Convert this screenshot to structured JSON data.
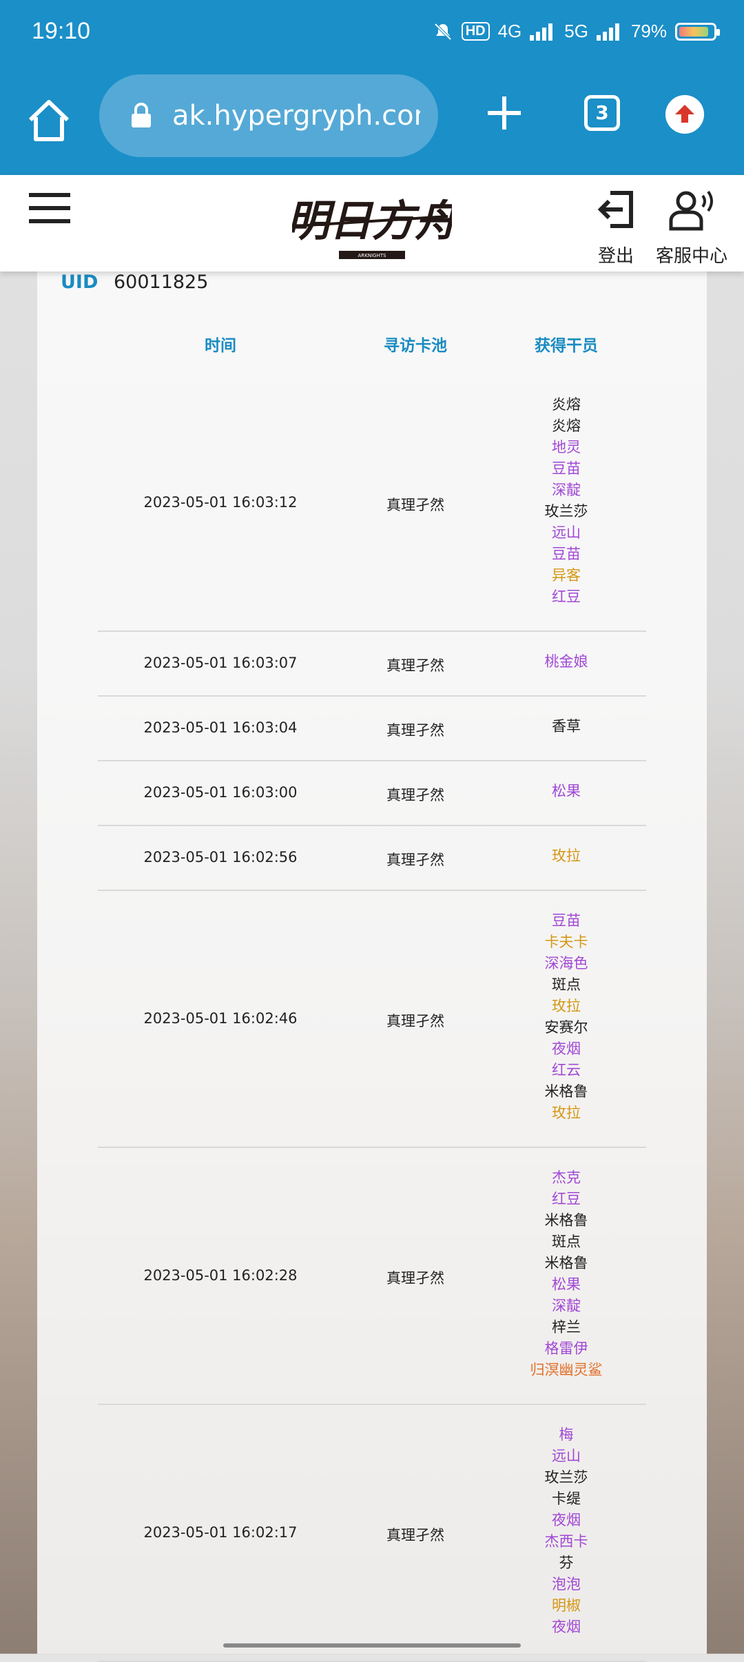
{
  "status_bar": {
    "time": "19:10",
    "hd": "HD",
    "network": "4G",
    "network2": "5G",
    "battery": "79%"
  },
  "browser": {
    "url": "ak.hypergryph.com/",
    "tab_count": "3"
  },
  "header": {
    "logout_label": "登出",
    "service_label": "客服中心",
    "logo_text": "明日方舟",
    "logo_sub": "ARKNIGHTS"
  },
  "uid": {
    "label": "UID",
    "value": "60011825"
  },
  "table": {
    "headers": [
      "时间",
      "寻访卡池",
      "获得干员"
    ],
    "rows": [
      {
        "time": "2023-05-01 16:03:12",
        "pool": "真理孑然",
        "operators": [
          {
            "name": "炎熔",
            "rarity": "3"
          },
          {
            "name": "炎熔",
            "rarity": "3"
          },
          {
            "name": "地灵",
            "rarity": "4"
          },
          {
            "name": "豆苗",
            "rarity": "4"
          },
          {
            "name": "深靛",
            "rarity": "4"
          },
          {
            "name": "玫兰莎",
            "rarity": "3"
          },
          {
            "name": "远山",
            "rarity": "4"
          },
          {
            "name": "豆苗",
            "rarity": "4"
          },
          {
            "name": "异客",
            "rarity": "5"
          },
          {
            "name": "红豆",
            "rarity": "4"
          }
        ]
      },
      {
        "time": "2023-05-01 16:03:07",
        "pool": "真理孑然",
        "operators": [
          {
            "name": "桃金娘",
            "rarity": "4"
          }
        ]
      },
      {
        "time": "2023-05-01 16:03:04",
        "pool": "真理孑然",
        "operators": [
          {
            "name": "香草",
            "rarity": "3"
          }
        ]
      },
      {
        "time": "2023-05-01 16:03:00",
        "pool": "真理孑然",
        "operators": [
          {
            "name": "松果",
            "rarity": "4"
          }
        ]
      },
      {
        "time": "2023-05-01 16:02:56",
        "pool": "真理孑然",
        "operators": [
          {
            "name": "玫拉",
            "rarity": "5"
          }
        ]
      },
      {
        "time": "2023-05-01 16:02:46",
        "pool": "真理孑然",
        "operators": [
          {
            "name": "豆苗",
            "rarity": "4"
          },
          {
            "name": "卡夫卡",
            "rarity": "5"
          },
          {
            "name": "深海色",
            "rarity": "4"
          },
          {
            "name": "斑点",
            "rarity": "3"
          },
          {
            "name": "玫拉",
            "rarity": "5"
          },
          {
            "name": "安赛尔",
            "rarity": "3"
          },
          {
            "name": "夜烟",
            "rarity": "4"
          },
          {
            "name": "红云",
            "rarity": "4"
          },
          {
            "name": "米格鲁",
            "rarity": "3"
          },
          {
            "name": "玫拉",
            "rarity": "5"
          }
        ]
      },
      {
        "time": "2023-05-01 16:02:28",
        "pool": "真理孑然",
        "operators": [
          {
            "name": "杰克",
            "rarity": "4"
          },
          {
            "name": "红豆",
            "rarity": "4"
          },
          {
            "name": "米格鲁",
            "rarity": "3"
          },
          {
            "name": "斑点",
            "rarity": "3"
          },
          {
            "name": "米格鲁",
            "rarity": "3"
          },
          {
            "name": "松果",
            "rarity": "4"
          },
          {
            "name": "深靛",
            "rarity": "4"
          },
          {
            "name": "梓兰",
            "rarity": "3"
          },
          {
            "name": "格雷伊",
            "rarity": "4"
          },
          {
            "name": "归溟幽灵鲨",
            "rarity": "6"
          }
        ]
      },
      {
        "time": "2023-05-01 16:02:17",
        "pool": "真理孑然",
        "operators": [
          {
            "name": "梅",
            "rarity": "4"
          },
          {
            "name": "远山",
            "rarity": "4"
          },
          {
            "name": "玫兰莎",
            "rarity": "3"
          },
          {
            "name": "卡缇",
            "rarity": "3"
          },
          {
            "name": "夜烟",
            "rarity": "4"
          },
          {
            "name": "杰西卡",
            "rarity": "4"
          },
          {
            "name": "芬",
            "rarity": "3"
          },
          {
            "name": "泡泡",
            "rarity": "4"
          },
          {
            "name": "明椒",
            "rarity": "5"
          },
          {
            "name": "夜烟",
            "rarity": "4"
          }
        ]
      }
    ]
  },
  "colors": {
    "brand_blue": "#1b8fc8",
    "header_text": "#1a8bc2",
    "rarity_3": "#222222",
    "rarity_4": "#a148d6",
    "rarity_5": "#d49714",
    "rarity_6": "#e0702a"
  }
}
